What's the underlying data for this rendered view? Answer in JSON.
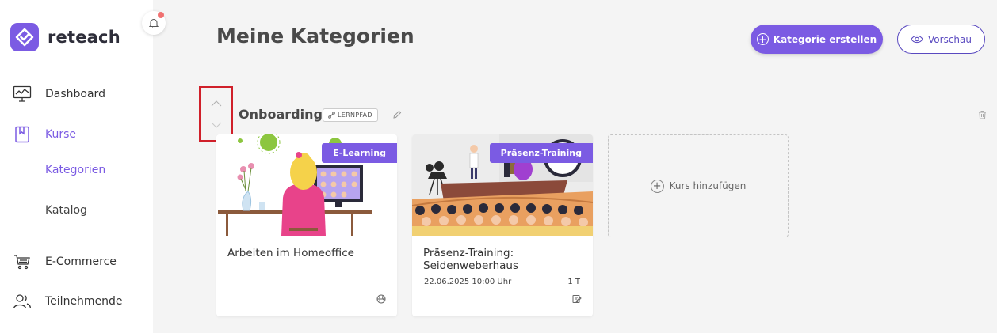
{
  "brand": {
    "name": "reteach",
    "accent": "#7b5be3"
  },
  "sidebar": {
    "items": [
      {
        "label": "Dashboard",
        "icon": "dashboard-monitor-icon"
      },
      {
        "label": "Kurse",
        "icon": "book-icon",
        "active": true
      },
      {
        "label": "E-Commerce",
        "icon": "cart-icon"
      },
      {
        "label": "Teilnehmende",
        "icon": "users-icon"
      }
    ],
    "sub_items": [
      {
        "label": "Kategorien",
        "active": true
      },
      {
        "label": "Katalog"
      }
    ]
  },
  "header": {
    "title": "Meine Kategorien",
    "create_label": "Kategorie erstellen",
    "preview_label": "Vorschau"
  },
  "category": {
    "title": "Onboarding",
    "badge": "LERNPFAD",
    "courses": [
      {
        "tag": "E-Learning",
        "title": "Arbeiten im Homeoffice"
      },
      {
        "tag": "Präsenz-Training",
        "title": "Präsenz-Training: Seidenweberhaus",
        "date": "22.06.2025 10:00 Uhr",
        "length": "1 T"
      }
    ],
    "add_label": "Kurs hinzufügen"
  }
}
